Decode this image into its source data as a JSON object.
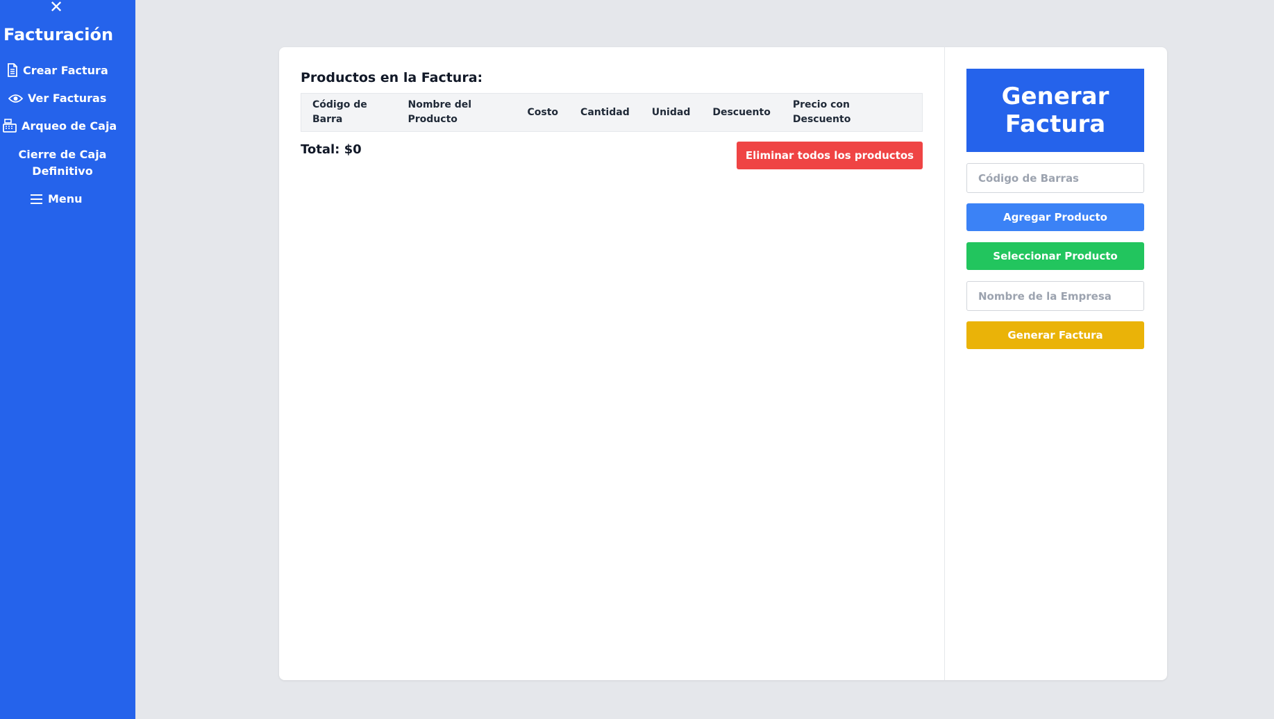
{
  "sidebar": {
    "close_symbol": "✕",
    "brand": "Facturación",
    "items": [
      {
        "label": "Crear Factura",
        "icon": "document-icon"
      },
      {
        "label": "Ver Facturas",
        "icon": "eye-icon"
      },
      {
        "label": "Arqueo de Caja",
        "icon": "cash-register-icon"
      },
      {
        "label": "Cierre de Caja Definitivo",
        "icon": ""
      },
      {
        "label": "Menu",
        "icon": "hamburger-icon"
      }
    ],
    "colors": {
      "background": "#2563eb"
    }
  },
  "invoice": {
    "title": "Productos en la Factura:",
    "columns": [
      "Código de Barra",
      "Nombre del Producto",
      "Costo",
      "Cantidad",
      "Unidad",
      "Descuento",
      "Precio con Descuento"
    ],
    "rows": [],
    "total_label": "Total: $0",
    "delete_all_label": "Eliminar todos los productos"
  },
  "panel": {
    "heading": "Generar Factura",
    "barcode_placeholder": "Código de Barras",
    "add_label": "Agregar Producto",
    "select_label": "Seleccionar Producto",
    "company_placeholder": "Nombre de la Empresa",
    "generate_label": "Generar Factura"
  },
  "colors": {
    "primary": "#2563eb",
    "add": "#3b82f6",
    "select": "#22c55e",
    "generate": "#eab308",
    "danger": "#ef4444"
  }
}
